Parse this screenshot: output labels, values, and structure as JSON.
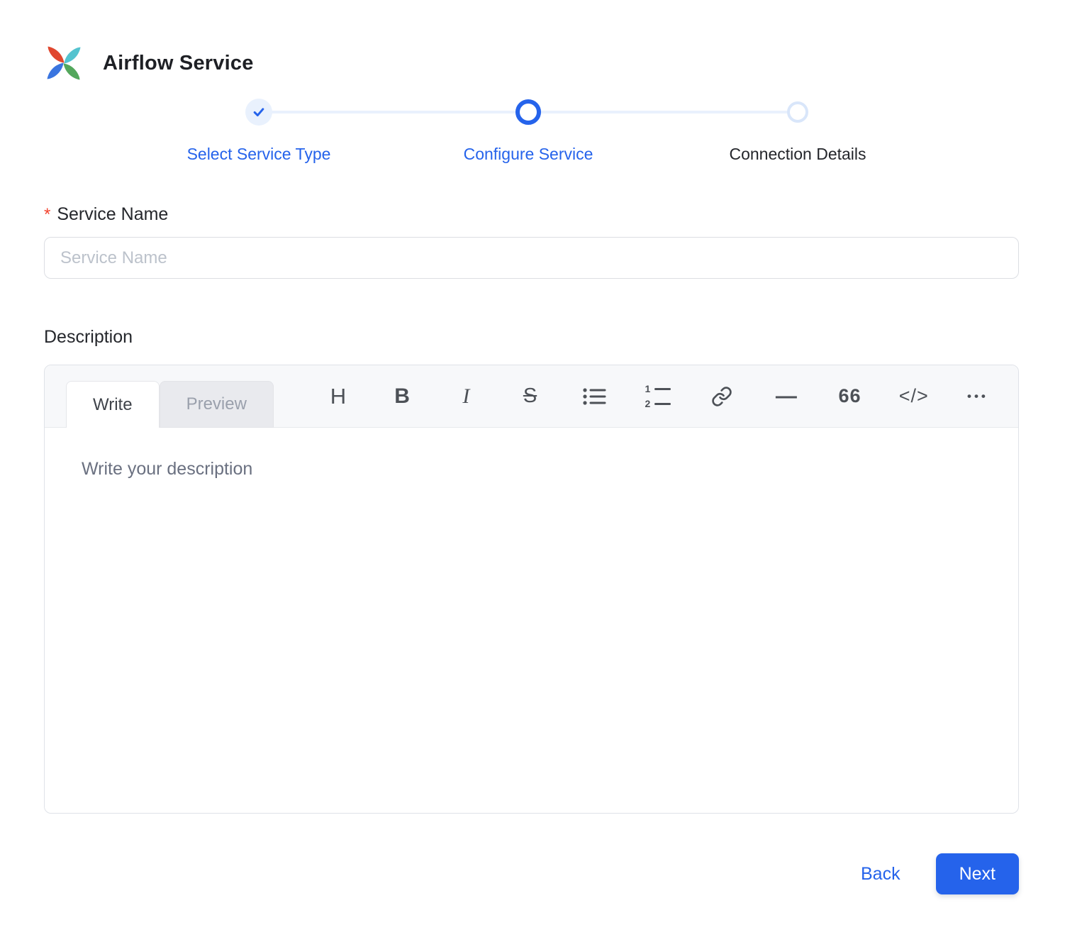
{
  "page": {
    "title": "Airflow Service"
  },
  "header": {
    "logo_icon": "airflow-pinwheel-icon"
  },
  "stepper": {
    "steps": [
      {
        "label": "Select Service Type",
        "state": "completed"
      },
      {
        "label": "Configure Service",
        "state": "active"
      },
      {
        "label": "Connection Details",
        "state": "pending"
      }
    ]
  },
  "form": {
    "service_name": {
      "label": "Service Name",
      "required_marker": "*",
      "placeholder": "Service Name",
      "value": ""
    },
    "description": {
      "label": "Description",
      "placeholder": "Write your description",
      "value": ""
    }
  },
  "editor": {
    "tabs": [
      {
        "label": "Write",
        "active": true
      },
      {
        "label": "Preview",
        "active": false
      }
    ],
    "toolbar": [
      {
        "name": "heading-icon",
        "glyph": "H"
      },
      {
        "name": "bold-icon",
        "glyph": "B"
      },
      {
        "name": "italic-icon",
        "glyph": "I"
      },
      {
        "name": "strikethrough-icon",
        "glyph": "S"
      },
      {
        "name": "unordered-list-icon"
      },
      {
        "name": "ordered-list-icon",
        "rows": [
          "1",
          "2"
        ]
      },
      {
        "name": "link-icon"
      },
      {
        "name": "horizontal-rule-icon",
        "glyph": "—"
      },
      {
        "name": "quote-icon",
        "glyph": "66"
      },
      {
        "name": "code-icon",
        "glyph": "</>"
      },
      {
        "name": "more-options-icon",
        "glyph": "•••"
      }
    ]
  },
  "footer": {
    "back_label": "Back",
    "next_label": "Next"
  },
  "colors": {
    "accent_blue": "#2563eb",
    "required_red": "#f3432e",
    "connector_blue": "#e9f1fd",
    "pending_ring": "#d9e6fa",
    "toolbar_bg": "#f7f8fa",
    "icon_gray": "#4d5157",
    "input_placeholder_gray": "#bcc2cb",
    "editor_placeholder_gray": "#6a7080",
    "logo_red": "#e0472f",
    "logo_teal": "#54c3cf",
    "logo_green": "#53a75c",
    "logo_blue": "#3a75e0"
  }
}
